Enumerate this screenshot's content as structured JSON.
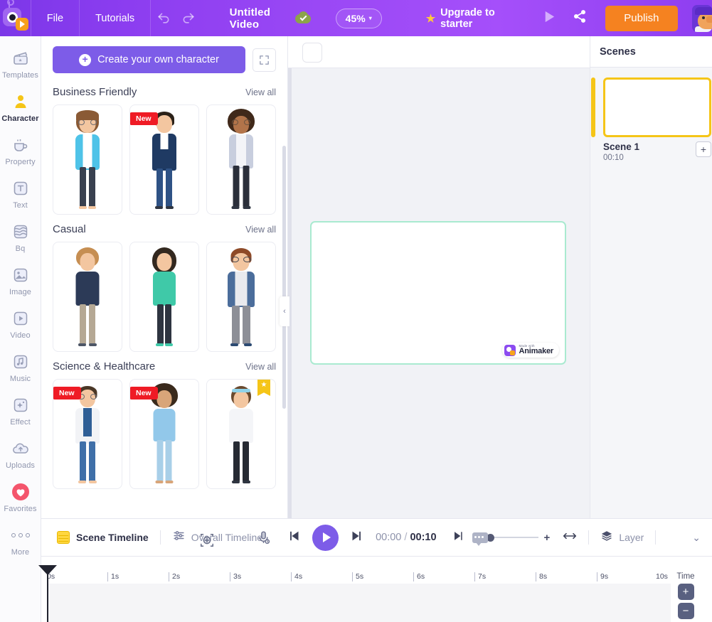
{
  "header": {
    "logo": "animaker-logo",
    "menu": [
      {
        "label": "File",
        "name": "menu-file"
      },
      {
        "label": "Tutorials",
        "name": "menu-tutorials"
      }
    ],
    "undo_icon": "undo-icon",
    "redo_icon": "redo-icon",
    "project_title": "Untitled Video",
    "save_status_icon": "cloud-saved-icon",
    "zoom_level": "45%",
    "zoom_caret": "▾",
    "upgrade_label": "Upgrade to starter",
    "upgrade_star": "★",
    "preview_icon": "preview-play-icon",
    "share_icon": "share-icon",
    "publish_label": "Publish",
    "avatar_name": "user-avatar",
    "accent_purple": "#7d5ce8",
    "publish_orange": "#f58220"
  },
  "rail": {
    "items": [
      {
        "label": "Templates",
        "icon": "templates-icon",
        "active": false
      },
      {
        "label": "Character",
        "icon": "character-icon",
        "active": true
      },
      {
        "label": "Property",
        "icon": "property-icon",
        "active": false
      },
      {
        "label": "Text",
        "icon": "text-icon",
        "active": false
      },
      {
        "label": "Bq",
        "icon": "background-icon",
        "active": false
      },
      {
        "label": "Image",
        "icon": "image-icon",
        "active": false
      },
      {
        "label": "Video",
        "icon": "video-icon",
        "active": false
      },
      {
        "label": "Music",
        "icon": "music-icon",
        "active": false
      },
      {
        "label": "Effect",
        "icon": "effect-icon",
        "active": false
      },
      {
        "label": "Uploads",
        "icon": "uploads-icon",
        "active": false
      },
      {
        "label": "Favorites",
        "icon": "favorites-heart-icon",
        "active": false
      },
      {
        "label": "More",
        "icon": "more-dots-icon",
        "active": false
      }
    ]
  },
  "library": {
    "create_label": "Create your own character",
    "create_plus": "+",
    "expand_icon": "expand-fullscreen-icon",
    "view_all_label": "View all",
    "sections": [
      {
        "title": "Business Friendly",
        "cards": [
          {
            "badge": "",
            "name": "character-card-business-1"
          },
          {
            "badge": "New",
            "name": "character-card-business-2"
          },
          {
            "badge": "",
            "name": "character-card-business-3"
          }
        ]
      },
      {
        "title": "Casual",
        "cards": [
          {
            "badge": "",
            "name": "character-card-casual-1"
          },
          {
            "badge": "",
            "name": "character-card-casual-2"
          },
          {
            "badge": "",
            "name": "character-card-casual-3"
          }
        ]
      },
      {
        "title": "Science & Healthcare",
        "cards": [
          {
            "badge": "New",
            "name": "character-card-science-1"
          },
          {
            "badge": "New",
            "name": "character-card-science-2"
          },
          {
            "badge": "star",
            "name": "character-card-science-3"
          }
        ]
      }
    ]
  },
  "stage": {
    "canvas_border_color": "#a9ead0",
    "watermark_small": "Made with",
    "watermark_big": "Animaker",
    "collapse_icon": "‹"
  },
  "scenes": {
    "panel_title": "Scenes",
    "items": [
      {
        "name": "Scene 1",
        "duration": "00:10",
        "selected": true
      }
    ],
    "add_scene_label": "+",
    "selected_color": "#f5c518"
  },
  "timeline": {
    "scene_timeline_label": "Scene Timeline",
    "scene_timeline_icon": "scene-timeline-icon",
    "overall_timeline_label": "Overall Timeline",
    "overall_timeline_icon": "overall-timeline-icon",
    "mic_icon": "mic-icon",
    "cursor_icon": "cursor-crosshair-icon",
    "prev_frame_icon": "skip-previous-icon",
    "play_icon": "play-icon",
    "next_frame_icon": "skip-next-icon",
    "current_time": "00:00",
    "time_separator": "/",
    "total_time": "00:10",
    "caption_icon": "caption-icon",
    "zoom_plus": "+",
    "fit_icon": "fit-width-icon",
    "layer_label": "Layer",
    "layer_icon": "layers-icon",
    "expand_chevron": "⌄",
    "ruler_ticks": [
      "0s",
      "1s",
      "2s",
      "3s",
      "4s",
      "5s",
      "6s",
      "7s",
      "8s",
      "9s",
      "10s"
    ],
    "playhead_position": "0s",
    "time_zoom_label": "Time",
    "time_zoom_in": "+",
    "time_zoom_out": "−"
  }
}
